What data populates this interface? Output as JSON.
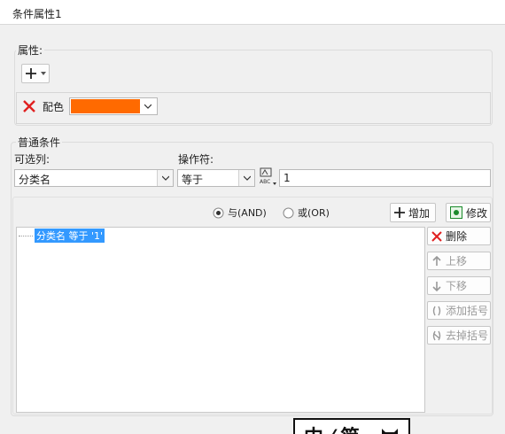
{
  "window": {
    "title": "条件属性1"
  },
  "properties": {
    "legend": "属性:",
    "add_icon": "plus-icon",
    "color_label": "配色",
    "color_value": "#ff6a00"
  },
  "conditions": {
    "legend": "普通条件",
    "column_label": "可选列:",
    "column_value": "分类名",
    "operator_label": "操作符:",
    "operator_value": "等于",
    "value_input": "1",
    "and_label": "与(AND)",
    "or_label": "或(OR)",
    "add_label": "增加",
    "modify_label": "修改",
    "list_items": [
      "分类名 等于 '1'"
    ],
    "delete_label": "删除",
    "move_up_label": "上移",
    "move_down_label": "下移",
    "add_bracket_label": "添加括号",
    "remove_bracket_label": "去掉括号"
  },
  "colors": {
    "accent": "#ff6a00",
    "selection": "#3399ff",
    "delete": "#e02020",
    "modify": "#1a8a2a"
  },
  "overlay": {
    "text": "中 ⁄ 简"
  }
}
